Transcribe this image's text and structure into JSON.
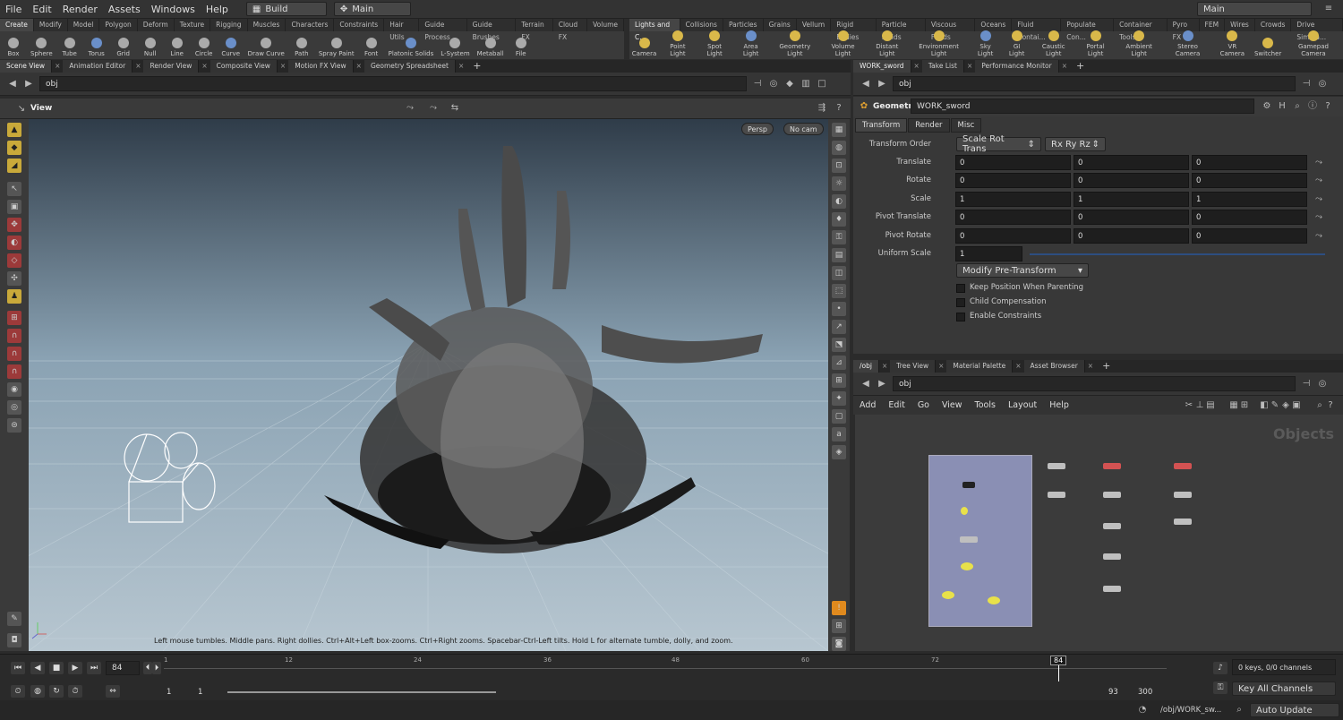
{
  "menubar": {
    "items": [
      "File",
      "Edit",
      "Render",
      "Assets",
      "Windows",
      "Help"
    ],
    "desktop": "Build",
    "context": "Main",
    "right_context": "Main"
  },
  "shelf_left": {
    "tabs": [
      "Create",
      "Modify",
      "Model",
      "Polygon",
      "Deform",
      "Texture",
      "Rigging",
      "Muscles",
      "Characters",
      "Constraints",
      "Hair Utils",
      "Guide Process",
      "Guide Brushes",
      "Terrain FX",
      "Cloud FX",
      "Volume"
    ],
    "tools": [
      {
        "label": "Box",
        "icon": "box-icon"
      },
      {
        "label": "Sphere",
        "icon": "sphere-icon"
      },
      {
        "label": "Tube",
        "icon": "tube-icon"
      },
      {
        "label": "Torus",
        "icon": "torus-icon"
      },
      {
        "label": "Grid",
        "icon": "grid-icon"
      },
      {
        "label": "Null",
        "icon": "null-icon"
      },
      {
        "label": "Line",
        "icon": "line-icon"
      },
      {
        "label": "Circle",
        "icon": "circle-icon"
      },
      {
        "label": "Curve",
        "icon": "curve-icon"
      },
      {
        "label": "Draw Curve",
        "icon": "draw-curve-icon"
      },
      {
        "label": "Path",
        "icon": "path-icon"
      },
      {
        "label": "Spray Paint",
        "icon": "spray-paint-icon"
      },
      {
        "label": "Font",
        "icon": "font-icon"
      },
      {
        "label": "Platonic Solids",
        "icon": "platonic-icon"
      },
      {
        "label": "L-System",
        "icon": "lsystem-icon"
      },
      {
        "label": "Metaball",
        "icon": "metaball-icon"
      },
      {
        "label": "File",
        "icon": "file-icon"
      }
    ]
  },
  "shelf_right": {
    "tabs": [
      "Lights and C...",
      "Collisions",
      "Particles",
      "Grains",
      "Vellum",
      "Rigid Bodies",
      "Particle Fluids",
      "Viscous Fluids",
      "Oceans",
      "Fluid Contai...",
      "Populate Con...",
      "Container Tools",
      "Pyro FX",
      "FEM",
      "Wires",
      "Crowds",
      "Drive Simula..."
    ],
    "tools": [
      {
        "label": "Camera",
        "icon": "camera-icon"
      },
      {
        "label": "Point Light",
        "icon": "point-light-icon"
      },
      {
        "label": "Spot Light",
        "icon": "spot-light-icon"
      },
      {
        "label": "Area Light",
        "icon": "area-light-icon"
      },
      {
        "label": "Geometry Light",
        "icon": "geometry-light-icon"
      },
      {
        "label": "Volume Light",
        "icon": "volume-light-icon"
      },
      {
        "label": "Distant Light",
        "icon": "distant-light-icon"
      },
      {
        "label": "Environment Light",
        "icon": "environment-light-icon"
      },
      {
        "label": "Sky Light",
        "icon": "sky-light-icon"
      },
      {
        "label": "GI Light",
        "icon": "gi-light-icon"
      },
      {
        "label": "Caustic Light",
        "icon": "caustic-light-icon"
      },
      {
        "label": "Portal Light",
        "icon": "portal-light-icon"
      },
      {
        "label": "Ambient Light",
        "icon": "ambient-light-icon"
      },
      {
        "label": "Stereo Camera",
        "icon": "stereo-camera-icon"
      },
      {
        "label": "VR Camera",
        "icon": "vr-camera-icon"
      },
      {
        "label": "Switcher",
        "icon": "switcher-icon"
      },
      {
        "label": "Gamepad Camera",
        "icon": "gamepad-camera-icon"
      }
    ]
  },
  "left_pane": {
    "tabs": [
      "Scene View",
      "Animation Editor",
      "Render View",
      "Composite View",
      "Motion FX View",
      "Geometry Spreadsheet"
    ],
    "path": "obj",
    "view_label": "View",
    "persp": "Persp",
    "cam": "No cam",
    "hint": "Left mouse tumbles. Middle pans. Right dollies. Ctrl+Alt+Left box-zooms. Ctrl+Right zooms. Spacebar-Ctrl-Left tilts. Hold L for alternate tumble, dolly, and zoom."
  },
  "params": {
    "tabs_top": [
      "WORK_sword",
      "Take List",
      "Performance Monitor"
    ],
    "path": "obj",
    "node_type": "Geometry",
    "node_name": "WORK_sword",
    "tabs": [
      "Transform",
      "Render",
      "Misc"
    ],
    "transform_order_label": "Transform Order",
    "transform_order": "Scale Rot Trans",
    "rot_order": "Rx Ry Rz",
    "rows": [
      {
        "label": "Translate",
        "values": [
          "0",
          "0",
          "0"
        ]
      },
      {
        "label": "Rotate",
        "values": [
          "0",
          "0",
          "0"
        ]
      },
      {
        "label": "Scale",
        "values": [
          "1",
          "1",
          "1"
        ]
      },
      {
        "label": "Pivot Translate",
        "values": [
          "0",
          "0",
          "0"
        ]
      },
      {
        "label": "Pivot Rotate",
        "values": [
          "0",
          "0",
          "0"
        ]
      }
    ],
    "uniform_scale_label": "Uniform Scale",
    "uniform_scale": "1",
    "modify_pre_transform": "Modify Pre-Transform",
    "checks": [
      "Keep Position When Parenting",
      "Child Compensation",
      "Enable Constraints"
    ]
  },
  "network": {
    "tabs": [
      "/obj",
      "Tree View",
      "Material Palette",
      "Asset Browser"
    ],
    "path": "obj",
    "menu": [
      "Add",
      "Edit",
      "Go",
      "View",
      "Tools",
      "Layout",
      "Help"
    ],
    "watermark": "Objects"
  },
  "timeline": {
    "frame": "84",
    "ticks": [
      "1",
      "12",
      "24",
      "36",
      "48",
      "60",
      "72"
    ],
    "marker": "84",
    "range_start": "1",
    "range_start2": "1",
    "range_end": "93",
    "range_end2": "300",
    "keys": "0 keys, 0/0 channels",
    "key_all": "Key All Channels"
  },
  "statusbar": {
    "path": "/obj/WORK_sw...",
    "update": "Auto Update"
  }
}
